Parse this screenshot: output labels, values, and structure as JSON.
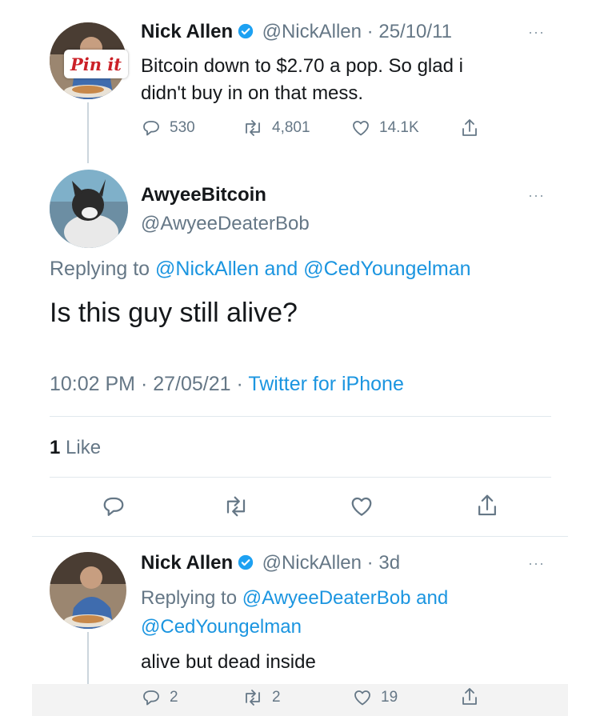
{
  "tweet1": {
    "name": "Nick Allen",
    "handle": "@NickAllen",
    "sep": " · ",
    "date": "25/10/11",
    "text_line1": "Bitcoin down to $2.70 a pop. So glad i",
    "text_line2": "didn't buy in on that mess.",
    "reply_count": "530",
    "retweet_count": "4,801",
    "like_count": "14.1K",
    "pin_label": "Pin it"
  },
  "tweet2": {
    "name": "AwyeeBitcoin",
    "handle": "@AwyeeDeaterBob",
    "replying_prefix": "Replying to ",
    "reply_to_1": "@NickAllen",
    "reply_and": " and ",
    "reply_to_2": "@CedYoungelman",
    "text": "Is this guy still alive?",
    "time": "10:02 PM · 27/05/21 · ",
    "source": "Twitter for iPhone",
    "likes_num": "1",
    "likes_label": " Like"
  },
  "tweet3": {
    "name": "Nick Allen",
    "handle": "@NickAllen",
    "sep": " · ",
    "date": "3d",
    "replying_prefix": "Replying to ",
    "reply_to_1": "@AwyeeDeaterBob",
    "reply_and": " and",
    "reply_to_2": "@CedYoungelman",
    "text": "alive but dead inside",
    "reply_count": "2",
    "retweet_count": "2",
    "like_count": "19"
  },
  "more_label": "···",
  "colors": {
    "link": "#1b95e0",
    "muted": "#657786",
    "verified": "#1da1f2",
    "pin": "#cb2027"
  },
  "icons": [
    "reply-icon",
    "retweet-icon",
    "like-icon",
    "share-icon",
    "verified-icon",
    "more-icon"
  ]
}
